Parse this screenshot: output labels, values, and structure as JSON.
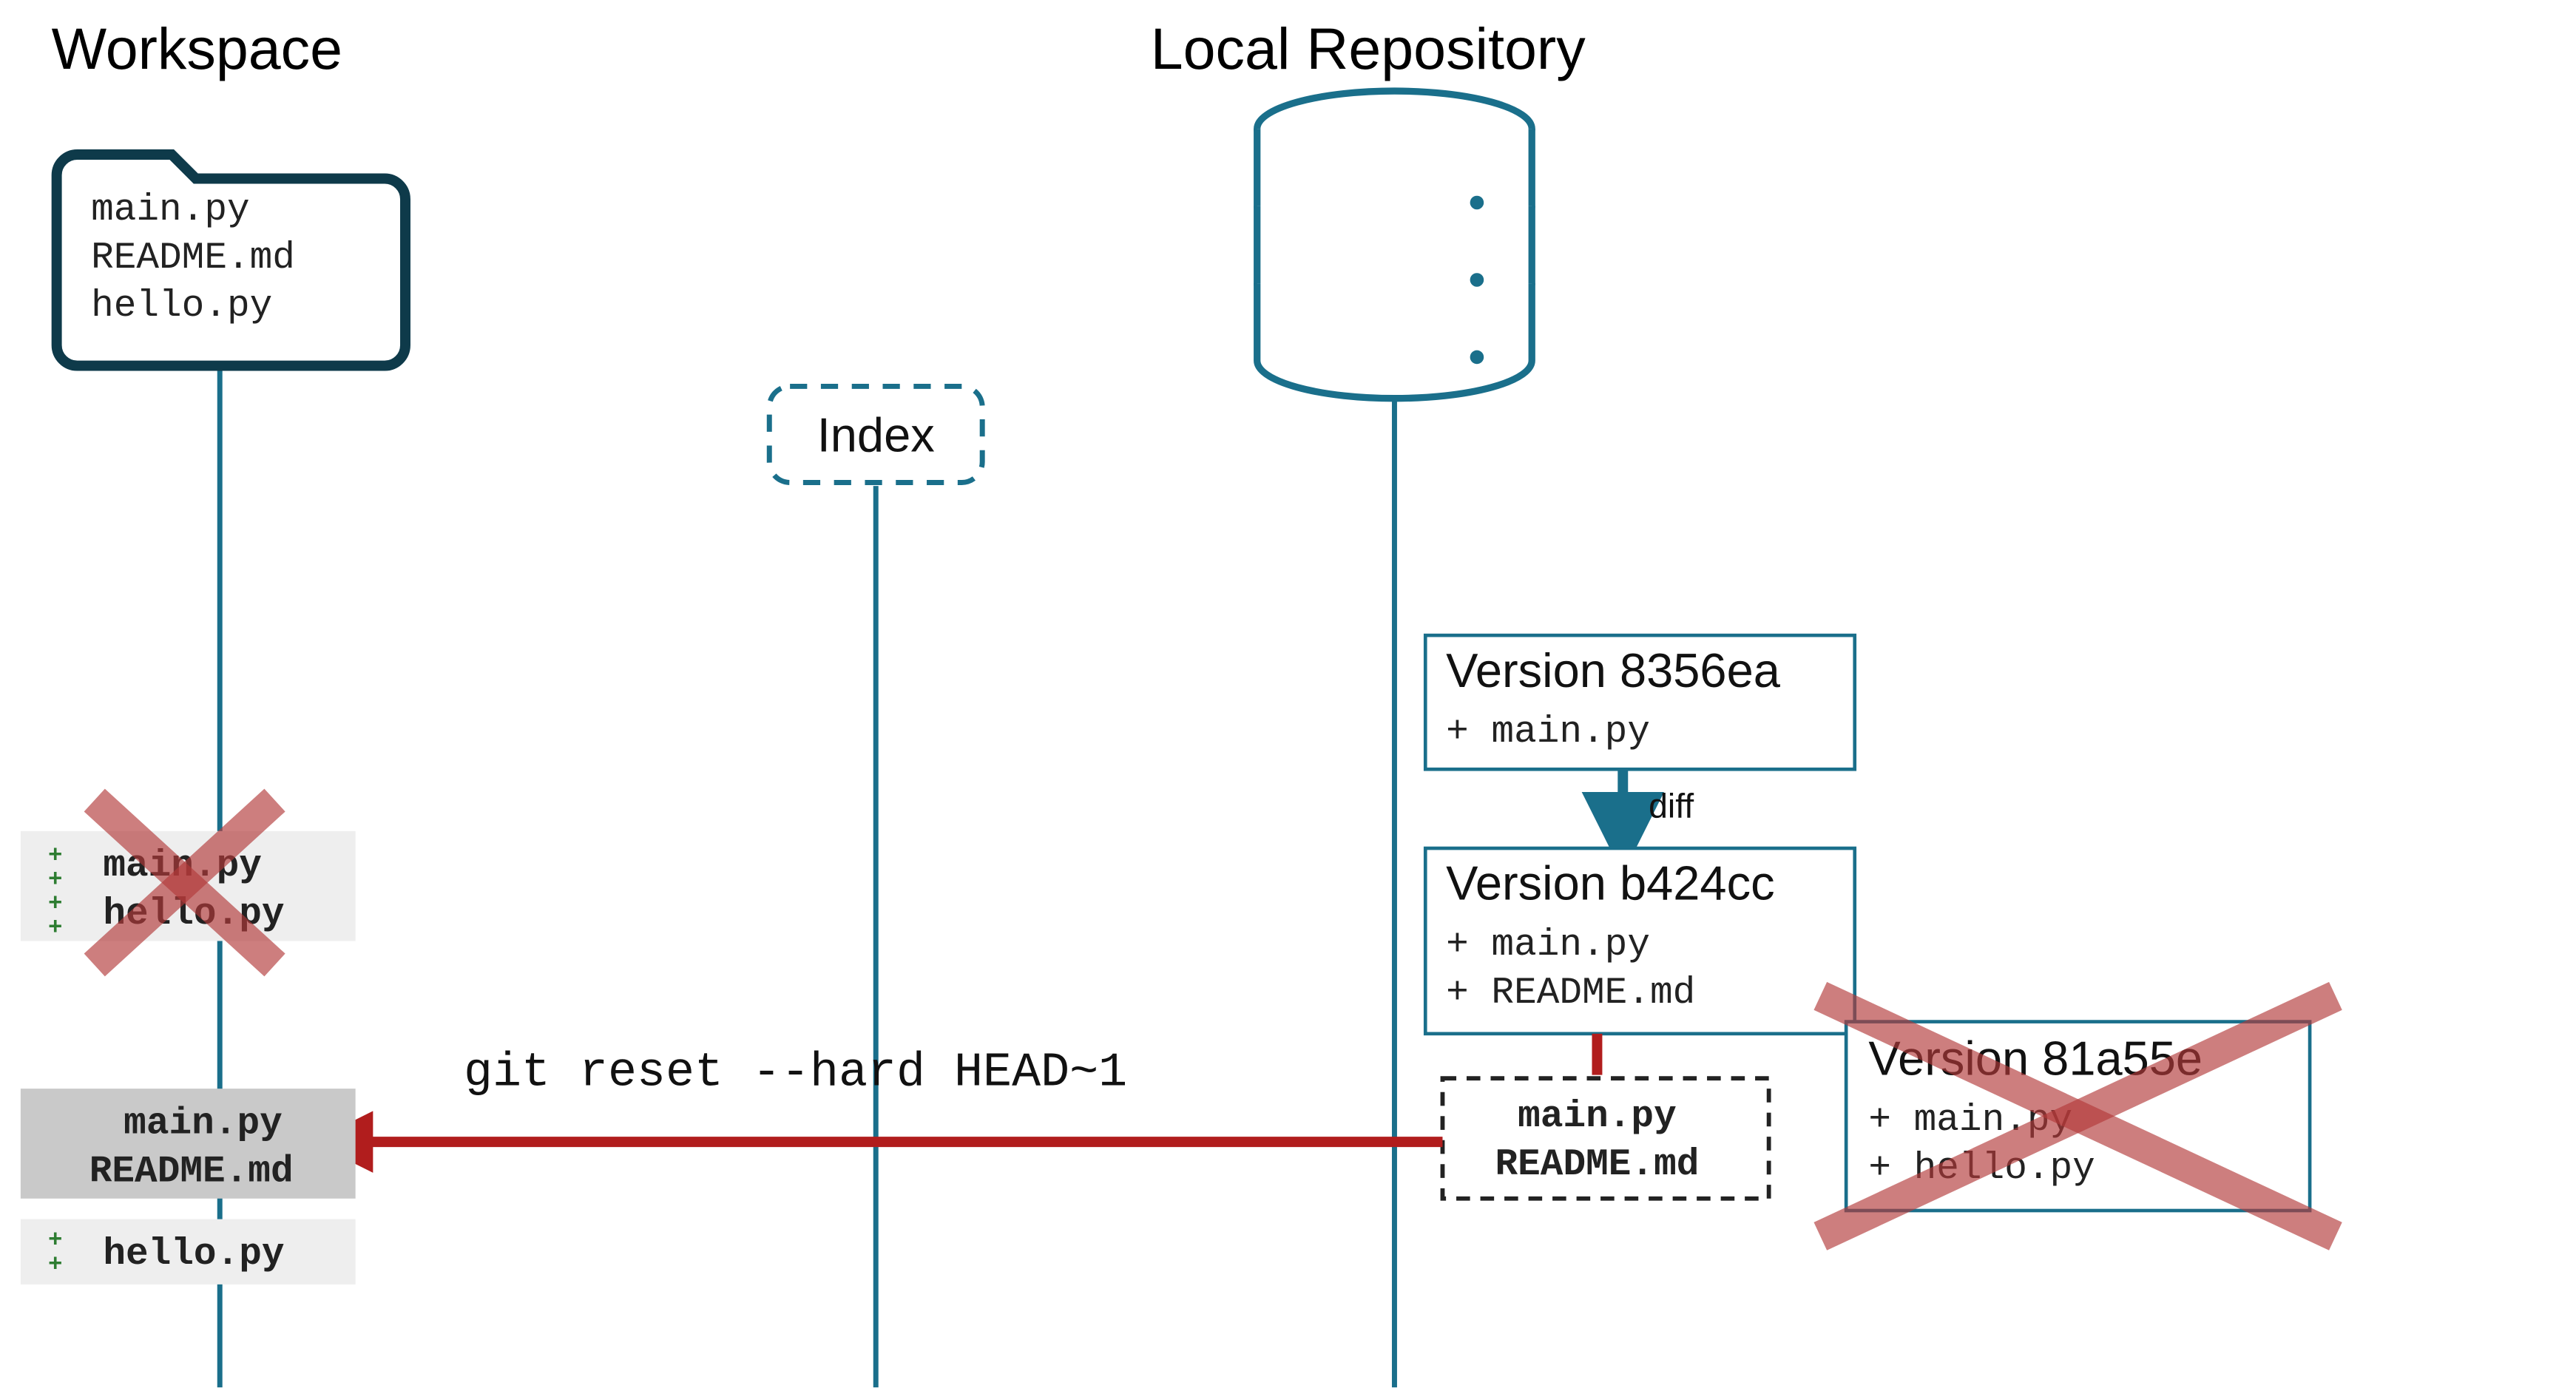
{
  "labels": {
    "workspace": "Workspace",
    "local_repo": "Local Repository",
    "index": "Index",
    "diff": "diff"
  },
  "command": "git reset --hard HEAD~1",
  "workspace_folder_files": [
    "main.py",
    "README.md",
    "hello.py"
  ],
  "workspace_changes_deleted": {
    "lines": [
      "main.py",
      "hello.py"
    ]
  },
  "workspace_result": {
    "lines": [
      "main.py",
      "README.md"
    ]
  },
  "workspace_stray": {
    "lines": [
      "hello.py"
    ]
  },
  "commits": [
    {
      "title": "Version 8356ea",
      "files": [
        "+ main.py"
      ]
    },
    {
      "title": "Version b424cc",
      "files": [
        "+ main.py",
        "+ README.md"
      ]
    }
  ],
  "deleted_commit": {
    "title": "Version 81a55e",
    "files": [
      "+ main.py",
      "+ hello.py"
    ]
  },
  "snapshot_box": {
    "lines": [
      "main.py",
      "README.md"
    ]
  },
  "colors": {
    "teal": "#1a6f8b",
    "red": "#b11d1d",
    "green": "#2e7d32"
  }
}
